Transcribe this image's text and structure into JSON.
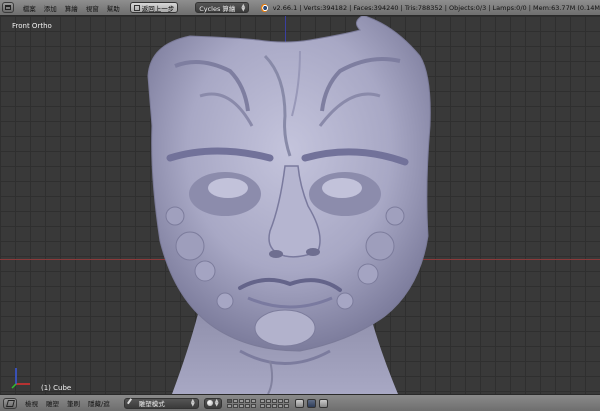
{
  "header": {
    "menus": [
      "檔案",
      "添加",
      "算繪",
      "視窗",
      "幫助"
    ],
    "back_button": "返回上一步",
    "render_engine": "Cycles 算繪",
    "stats": "v2.66.1 | Verts:394182 | Faces:394240 | Tris:788352 | Objects:0/3 | Lamps:0/0 | Mem:63.77M (0.14M"
  },
  "viewport": {
    "view_name": "Front Ortho",
    "active_object": "(1) Cube"
  },
  "footer": {
    "menus": [
      "檢視",
      "雕塑",
      "筆刷",
      "隱藏/遮"
    ],
    "mode": "雕塑模式"
  },
  "colors": {
    "x_axis": "#8a3a3a",
    "z_axis": "#3a3fa0",
    "grid": "#2f2f2f",
    "background": "#393939",
    "mesh": "#a9a9c6"
  },
  "icons": [
    "editor-type-icon",
    "blender-logo-icon",
    "view-type-icon",
    "brush-icon",
    "viewport-shading-icon",
    "layer-grid",
    "render-tool-icon",
    "camera-tool-icon"
  ]
}
